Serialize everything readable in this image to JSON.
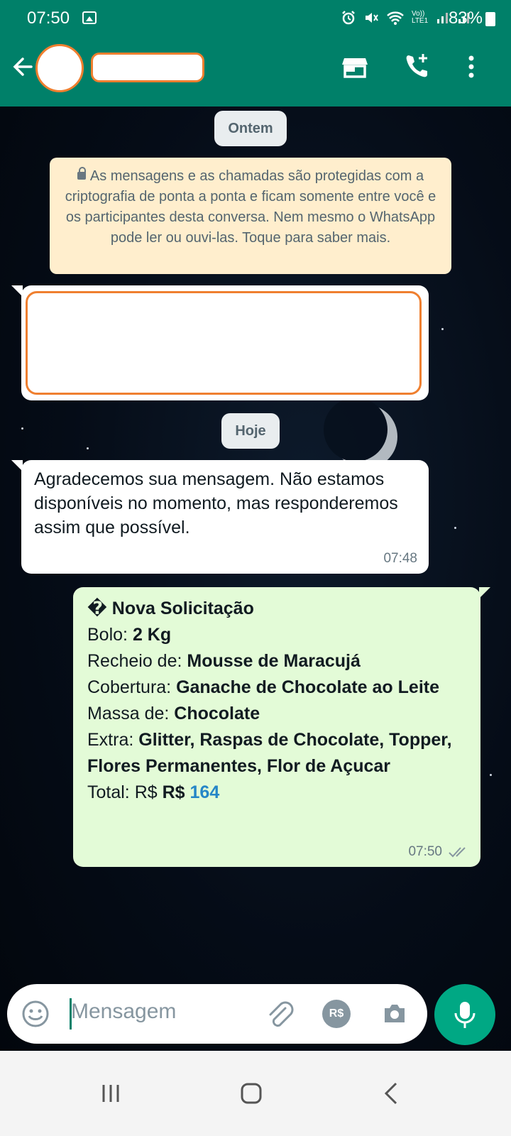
{
  "status_bar": {
    "time": "07:50",
    "network": "Vo)) LTE1",
    "battery": "83%"
  },
  "header": {
    "contact_name": "",
    "colors": {
      "primary": "#008069",
      "redaction": "#ef7f2f"
    }
  },
  "chat": {
    "date_yesterday": "Ontem",
    "encryption_notice": "As mensagens e as chamadas são protegidas com a criptografia de ponta a ponta e ficam somente entre você e os participantes desta conversa. Nem mesmo o WhatsApp pode ler ou ouvi-las. Toque para saber mais.",
    "date_today": "Hoje",
    "auto_reply": {
      "text": "Agradecemos sua mensagem. Não estamos disponíveis no momento, mas responderemos assim que possível.",
      "time": "07:48"
    },
    "order": {
      "title": "� Nova Solicitação",
      "bolo_label": "Bolo: ",
      "bolo_value": "2 Kg",
      "recheio_label": "Recheio de: ",
      "recheio_value": "Mousse de Maracujá",
      "cobertura_label": "Cobertura: ",
      "cobertura_value": "Ganache de Chocolate ao Leite",
      "massa_label": "Massa de: ",
      "massa_value": "Chocolate",
      "extra_label": "Extra: ",
      "extra_value": "Glitter, Raspas de Chocolate, Topper, Flores Permanentes, Flor de Açucar",
      "total_label": "Total: R$ ",
      "total_currency": "R$ ",
      "total_value": "164",
      "time": "07:50"
    }
  },
  "input": {
    "placeholder": "Mensagem",
    "payment_icon_text": "R$"
  },
  "icons": {
    "back": "arrow-left",
    "store": "store-icon",
    "call": "add-call-icon",
    "menu": "more-vertical-icon",
    "emoji": "emoji-icon",
    "attach": "paperclip-icon",
    "payment": "payment-icon",
    "camera": "camera-icon",
    "mic": "mic-icon"
  }
}
